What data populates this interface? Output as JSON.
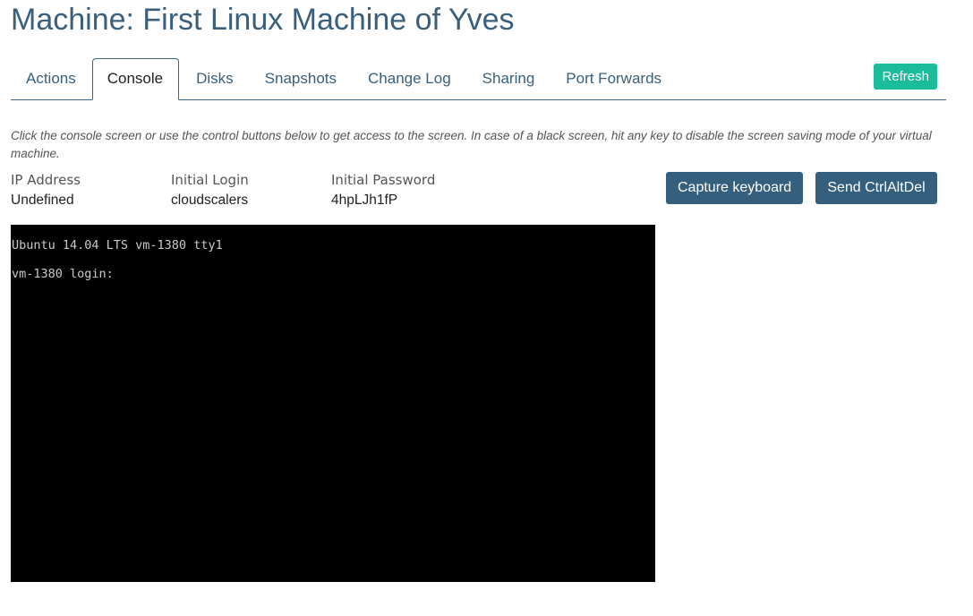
{
  "page": {
    "title": "Machine: First Linux Machine of Yves"
  },
  "tabs": [
    {
      "label": "Actions",
      "active": false
    },
    {
      "label": "Console",
      "active": true
    },
    {
      "label": "Disks",
      "active": false
    },
    {
      "label": "Snapshots",
      "active": false
    },
    {
      "label": "Change Log",
      "active": false
    },
    {
      "label": "Sharing",
      "active": false
    },
    {
      "label": "Port Forwards",
      "active": false
    }
  ],
  "toolbar": {
    "refresh_label": "Refresh"
  },
  "console_panel": {
    "instructions": "Click the console screen or use the control buttons below to get access to the screen. In case of a black screen, hit any key to disable the screen saving mode of your virtual machine.",
    "info": {
      "ip_label": "IP Address",
      "ip_value": "Undefined",
      "login_label": "Initial Login",
      "login_value": "cloudscalers",
      "password_label": "Initial Password",
      "password_value": "4hpLJh1fP"
    },
    "capture_keyboard_label": "Capture keyboard",
    "send_ctrlaltdel_label": "Send CtrlAltDel",
    "screen": {
      "line1": "Ubuntu 14.04 LTS vm-1380 tty1",
      "line2": "vm-1380 login:"
    }
  },
  "colors": {
    "title": "#3a5f7d",
    "accent_green": "#1abc9c",
    "button_dark": "#34607d"
  }
}
